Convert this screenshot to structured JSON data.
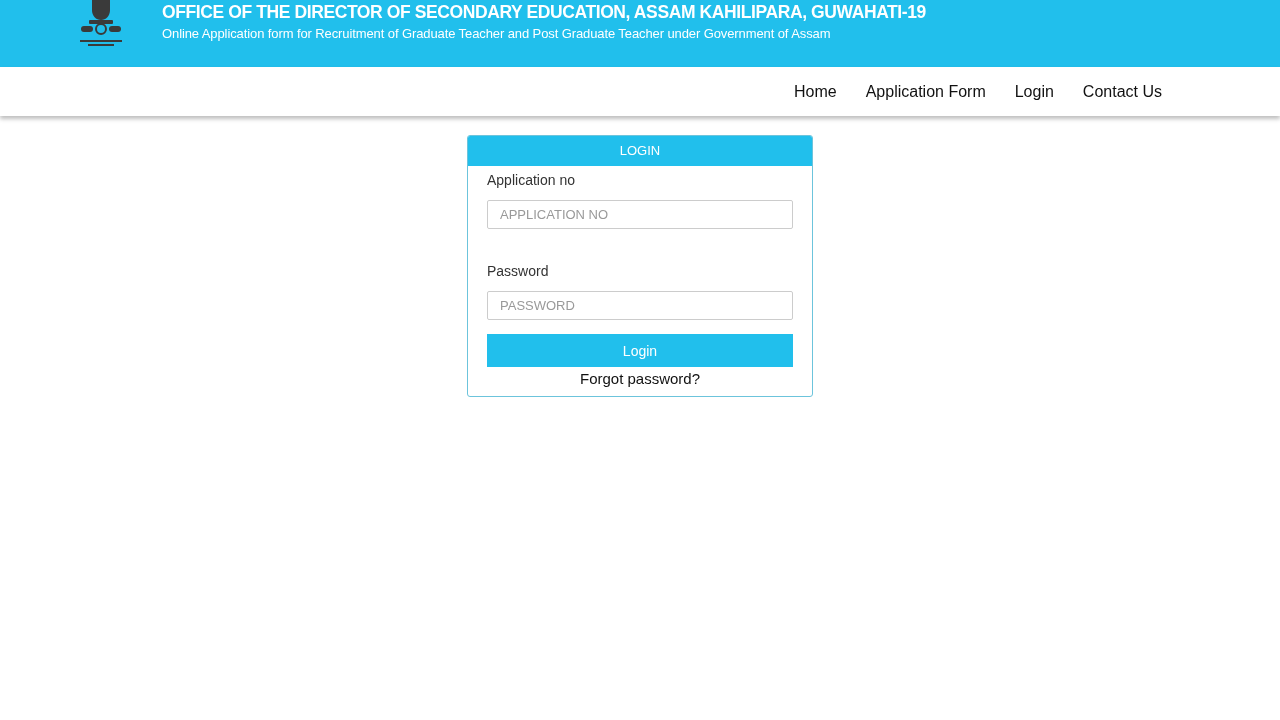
{
  "header": {
    "title": "OFFICE OF THE DIRECTOR OF SECONDARY EDUCATION, ASSAM KAHILIPARA, GUWAHATI-19",
    "subtitle": "Online Application form for Recruitment of Graduate Teacher and Post Graduate Teacher under Government of Assam"
  },
  "nav": [
    {
      "label": "Home"
    },
    {
      "label": "Application Form"
    },
    {
      "label": "Login"
    },
    {
      "label": "Contact Us"
    }
  ],
  "login": {
    "title": "LOGIN",
    "fields": [
      {
        "label": "Application no",
        "placeholder": "APPLICATION NO"
      },
      {
        "label": "Password",
        "placeholder": "PASSWORD"
      }
    ],
    "button": "Login",
    "forgot": "Forgot password?"
  }
}
